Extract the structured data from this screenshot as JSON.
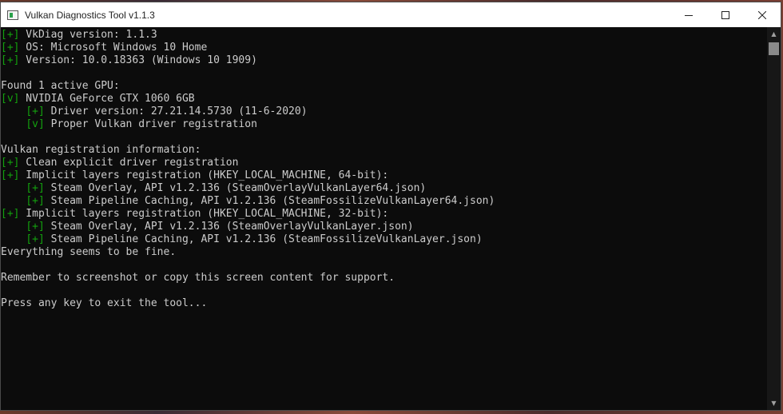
{
  "window": {
    "title": "Vulkan Diagnostics Tool v1.1.3",
    "controls": {
      "minimize": "minimize-icon",
      "maximize": "maximize-icon",
      "close": "close-icon"
    }
  },
  "console": {
    "lines": [
      {
        "indent": "",
        "mark": "[+]",
        "mark_color": "green",
        "text": " VkDiag version: 1.1.3"
      },
      {
        "indent": "",
        "mark": "[+]",
        "mark_color": "green",
        "text": " OS: Microsoft Windows 10 Home"
      },
      {
        "indent": "",
        "mark": "[+]",
        "mark_color": "green",
        "text": " Version: 10.0.18363 (Windows 10 1909)"
      },
      {
        "indent": "",
        "mark": "",
        "mark_color": "",
        "text": ""
      },
      {
        "indent": "",
        "mark": "",
        "mark_color": "",
        "text": "Found 1 active GPU:"
      },
      {
        "indent": "",
        "mark": "[v]",
        "mark_color": "green",
        "text": " NVIDIA GeForce GTX 1060 6GB"
      },
      {
        "indent": "    ",
        "mark": "[+]",
        "mark_color": "green",
        "text": " Driver version: 27.21.14.5730 (11-6-2020)"
      },
      {
        "indent": "    ",
        "mark": "[v]",
        "mark_color": "green",
        "text": " Proper Vulkan driver registration"
      },
      {
        "indent": "",
        "mark": "",
        "mark_color": "",
        "text": ""
      },
      {
        "indent": "",
        "mark": "",
        "mark_color": "",
        "text": "Vulkan registration information:"
      },
      {
        "indent": "",
        "mark": "[+]",
        "mark_color": "green",
        "text": " Clean explicit driver registration"
      },
      {
        "indent": "",
        "mark": "[+]",
        "mark_color": "green",
        "text": " Implicit layers registration (HKEY_LOCAL_MACHINE, 64-bit):"
      },
      {
        "indent": "    ",
        "mark": "[+]",
        "mark_color": "green",
        "text": " Steam Overlay, API v1.2.136 (SteamOverlayVulkanLayer64.json)"
      },
      {
        "indent": "    ",
        "mark": "[+]",
        "mark_color": "green",
        "text": " Steam Pipeline Caching, API v1.2.136 (SteamFossilizeVulkanLayer64.json)"
      },
      {
        "indent": "",
        "mark": "[+]",
        "mark_color": "green",
        "text": " Implicit layers registration (HKEY_LOCAL_MACHINE, 32-bit):"
      },
      {
        "indent": "    ",
        "mark": "[+]",
        "mark_color": "green",
        "text": " Steam Overlay, API v1.2.136 (SteamOverlayVulkanLayer.json)"
      },
      {
        "indent": "    ",
        "mark": "[+]",
        "mark_color": "green",
        "text": " Steam Pipeline Caching, API v1.2.136 (SteamFossilizeVulkanLayer.json)"
      },
      {
        "indent": "",
        "mark": "",
        "mark_color": "",
        "text": "Everything seems to be fine."
      },
      {
        "indent": "",
        "mark": "",
        "mark_color": "",
        "text": ""
      },
      {
        "indent": "",
        "mark": "",
        "mark_color": "",
        "text": "Remember to screenshot or copy this screen content for support."
      },
      {
        "indent": "",
        "mark": "",
        "mark_color": "",
        "text": ""
      },
      {
        "indent": "",
        "mark": "",
        "mark_color": "",
        "text": "Press any key to exit the tool..."
      }
    ]
  },
  "colors": {
    "console_bg": "#0c0c0c",
    "console_text": "#cccccc",
    "green": "#13a10e",
    "titlebar_bg": "#ffffff"
  }
}
